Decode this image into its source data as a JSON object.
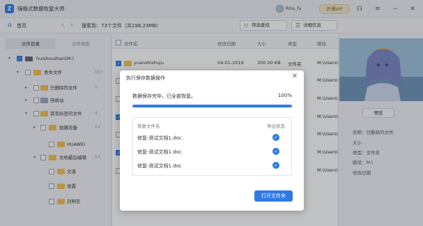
{
  "app": {
    "title": "嗨格式数据恢复大师",
    "logo": "Z",
    "username": "Rita_fu",
    "vip_label": "开通VIP"
  },
  "window_icons": [
    "headset-icon",
    "menu-icon",
    "minimize-icon",
    "close-icon"
  ],
  "toolbar": {
    "home_label": "首页",
    "search_label": "搜索到：73个文件（共198.23MB）",
    "filter_label": "筛选查找",
    "detail_label": "详细信息"
  },
  "left_tabs": [
    "文件目录",
    "文件类型"
  ],
  "tree": [
    {
      "label": "huishouzhan(M:)",
      "count": "",
      "kind": "drive",
      "checked": true
    },
    {
      "label": "丢失文件",
      "count": "663",
      "kind": "folder",
      "checked": false
    },
    {
      "label": "已删除的文件",
      "count": "0",
      "kind": "folder",
      "checked": false
    },
    {
      "label": "回收站",
      "count": "",
      "kind": "folder",
      "checked": false
    },
    {
      "label": "其有标签的文件",
      "count": "4",
      "kind": "folder",
      "checked": false
    },
    {
      "label": "拍摄设备",
      "count": "64",
      "kind": "folder",
      "checked": false
    },
    {
      "label": "HUAWEI",
      "count": "",
      "kind": "folder",
      "checked": false
    },
    {
      "label": "文档最后编辑",
      "count": "64",
      "kind": "folder",
      "checked": false
    },
    {
      "label": "文道",
      "count": "",
      "kind": "folder",
      "checked": false
    },
    {
      "label": "张霞",
      "count": "",
      "kind": "folder",
      "checked": false
    },
    {
      "label": "刘明东",
      "count": "",
      "kind": "folder",
      "checked": false
    }
  ],
  "list": {
    "headers": [
      "文件名",
      "修改日期",
      "大小",
      "类型",
      "路径"
    ],
    "rows": [
      {
        "name": "yuanshishuju",
        "date": "04-01-2019",
        "size": "300.00 KB",
        "type": "文件夹",
        "path": "M:\\Users\\"
      },
      {
        "name": "",
        "date": "",
        "size": "",
        "type": "",
        "path": "M:\\Users\\"
      },
      {
        "name": "",
        "date": "",
        "size": "",
        "type": "",
        "path": "M:\\Users\\"
      },
      {
        "name": "",
        "date": "",
        "size": "",
        "type": "",
        "path": "M:\\Users\\"
      },
      {
        "name": "",
        "date": "",
        "size": "",
        "type": "",
        "path": "M:\\Users\\"
      },
      {
        "name": "",
        "date": "",
        "size": "",
        "type": "",
        "path": "M:\\Users\\"
      },
      {
        "name": "",
        "date": "",
        "size": "",
        "type": "",
        "path": "M:\\Users\\"
      }
    ]
  },
  "preview": {
    "button": "预览",
    "meta": [
      "名称：已删除的文件",
      "大小",
      "类型：文件夹",
      "路径：M:\\",
      "修改日期"
    ]
  },
  "dialog": {
    "title": "执行保存数据操作",
    "status": "数据保存完毕，已全部恢复。",
    "percent": "100%",
    "progress": 1.0,
    "col_name": "恢复文件名",
    "col_status": "导出状态",
    "files": [
      "修复-测试文档1.doc",
      "修复-测试文档1.doc",
      "修复-测试文档1.doc"
    ],
    "open_button": "打开文件夹"
  },
  "colors": {
    "accent": "#2f7ae5",
    "folder": "#f5c04b"
  }
}
